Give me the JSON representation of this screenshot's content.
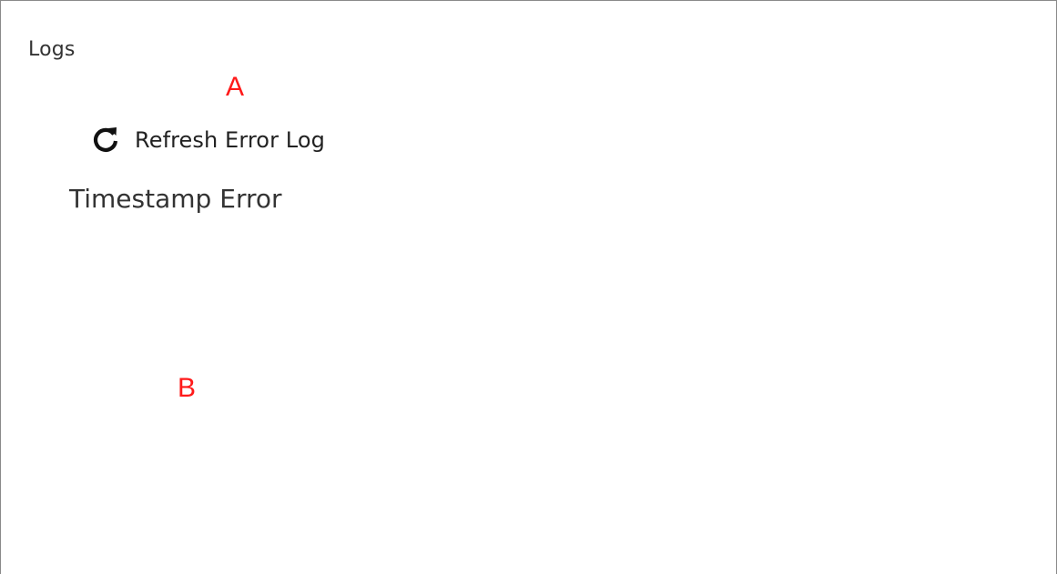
{
  "panel": {
    "title": "Logs"
  },
  "annotations": {
    "marker_a": "A",
    "marker_b": "B",
    "color": "#ff1a1a"
  },
  "toolbar": {
    "refresh_label": "Refresh Error Log",
    "refresh_icon": "refresh-icon"
  },
  "log_table": {
    "columns": [
      "Timestamp",
      "Error"
    ],
    "rows": []
  }
}
